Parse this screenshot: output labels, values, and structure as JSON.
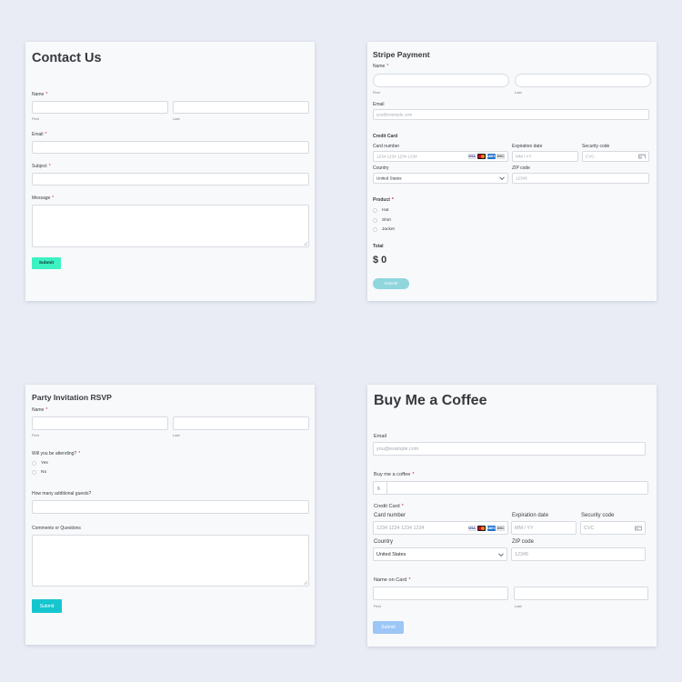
{
  "contact": {
    "title": "Contact Us",
    "name_label": "Name",
    "first_sub": "First",
    "last_sub": "Last",
    "email_label": "Email",
    "subject_label": "Subject",
    "message_label": "Message",
    "submit_label": "Submit",
    "required_mark": "*"
  },
  "stripe": {
    "title": "Stripe Payment",
    "name_label": "Name",
    "first_sub": "First",
    "last_sub": "Last",
    "email_label": "Email",
    "email_placeholder": "you@example.com",
    "credit_card_heading": "Credit Card",
    "card_number_label": "Card number",
    "card_number_placeholder": "1234 1234 1234 1234",
    "expiration_label": "Expiration date",
    "expiration_placeholder": "MM / YY",
    "security_label": "Security code",
    "security_placeholder": "CVC",
    "country_label": "Country",
    "country_value": "United States",
    "zip_label": "ZIP code",
    "zip_placeholder": "12345",
    "product_label": "Product",
    "products": [
      "Hat",
      "Shirt",
      "Jacket"
    ],
    "total_label": "Total",
    "total_value": "$ 0",
    "submit_label": "Submit",
    "required_mark": "*"
  },
  "party": {
    "title": "Party Invitation RSVP",
    "name_label": "Name",
    "first_sub": "First",
    "last_sub": "Last",
    "attending_label": "Will you be attending?",
    "attending_options": [
      "Yes",
      "No"
    ],
    "guests_label": "How many additional guests?",
    "comments_label": "Comments or Questions",
    "submit_label": "Submit",
    "required_mark": "*"
  },
  "coffee": {
    "title": "Buy Me a Coffee",
    "email_label": "Email",
    "email_placeholder": "you@example.com",
    "amount_label": "Buy me a coffee",
    "currency_symbol": "$",
    "credit_card_label": "Credit Card",
    "card_number_label": "Card number",
    "card_number_placeholder": "1234 1234 1234 1234",
    "expiration_label": "Expiration date",
    "expiration_placeholder": "MM / YY",
    "security_label": "Security code",
    "security_placeholder": "CVC",
    "country_label": "Country",
    "country_value": "United States",
    "zip_label": "ZIP code",
    "zip_placeholder": "12345",
    "name_on_card_label": "Name on Card",
    "first_sub": "First",
    "last_sub": "Last",
    "submit_label": "Submit",
    "required_mark": "*"
  },
  "card_brands": [
    "VISA",
    "AMEX",
    "DISC"
  ],
  "colors": {
    "page_bg": "#e9ecf4",
    "card_bg": "#f7f9fb",
    "contact_submit": "#3cf2c2",
    "stripe_submit": "#8fd6dd",
    "party_submit": "#16c6cf",
    "coffee_submit": "#9cc6f5",
    "required": "#e0203c"
  }
}
